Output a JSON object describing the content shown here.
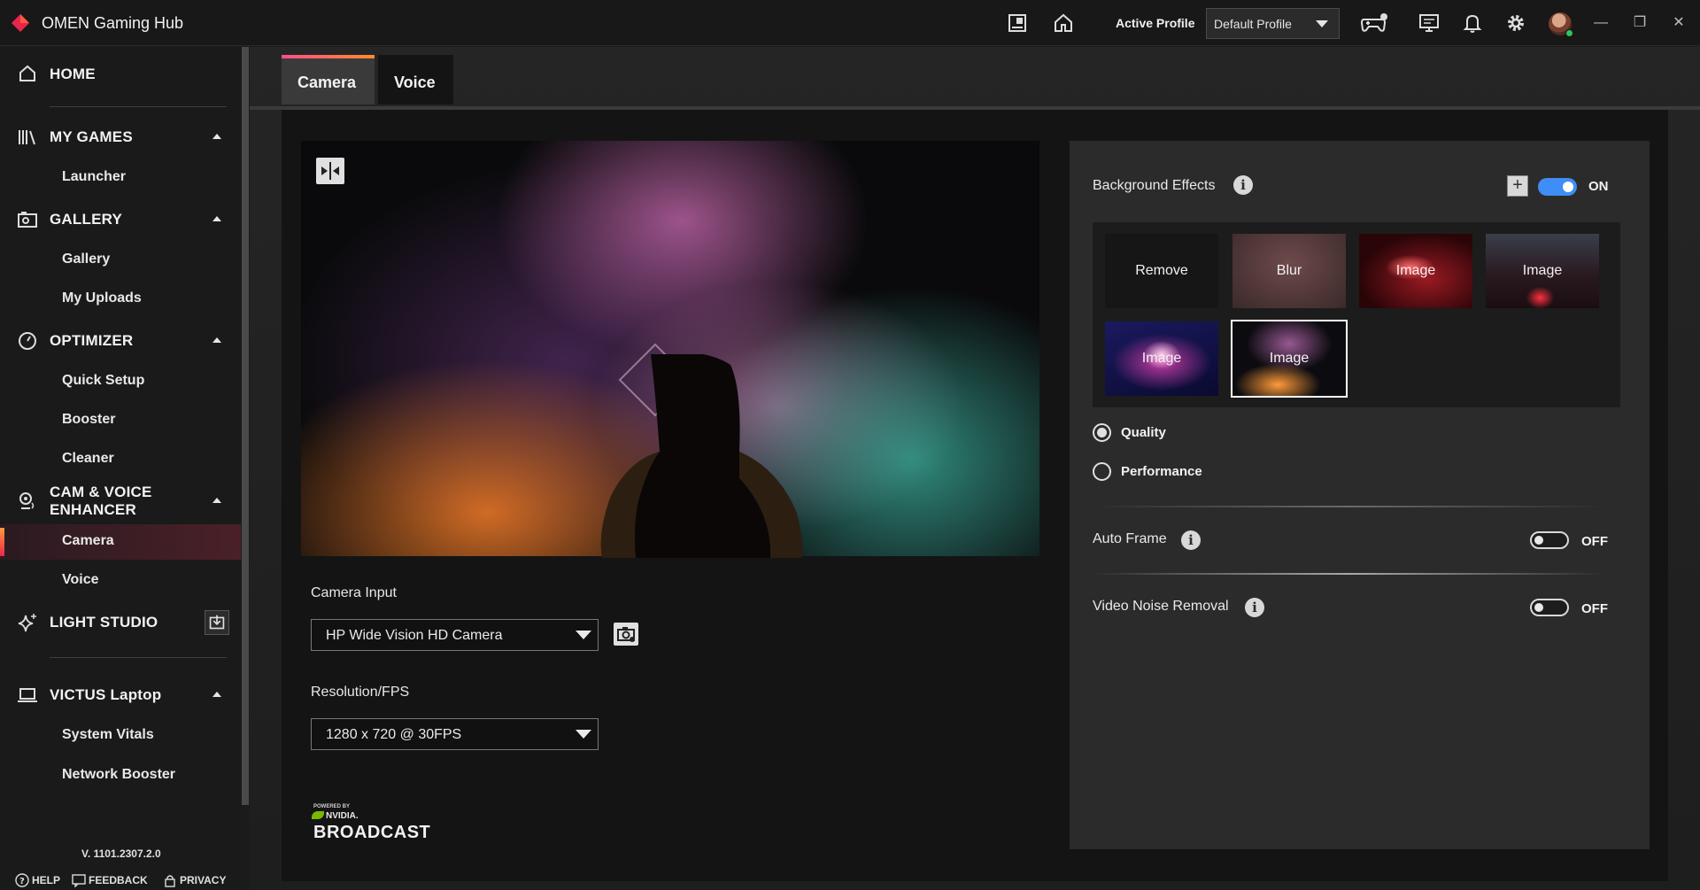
{
  "app": {
    "title": "OMEN Gaming Hub",
    "accent": "#e8264d"
  },
  "titlebar": {
    "active_profile_label": "Active Profile",
    "profile_value": "Default Profile",
    "icons": [
      "news-icon",
      "home-icon",
      "controller-icon",
      "display-icon",
      "bell-icon",
      "gear-icon",
      "avatar"
    ]
  },
  "sidebar": {
    "home": "HOME",
    "my_games": "MY GAMES",
    "launcher": "Launcher",
    "gallery_section": "GALLERY",
    "gallery": "Gallery",
    "my_uploads": "My Uploads",
    "optimizer": "OPTIMIZER",
    "quick_setup": "Quick Setup",
    "booster": "Booster",
    "cleaner": "Cleaner",
    "cam_voice_1": "CAM & VOICE",
    "cam_voice_2": "ENHANCER",
    "camera": "Camera",
    "voice": "Voice",
    "light_studio": "LIGHT STUDIO",
    "victus": "VICTUS Laptop",
    "system_vitals": "System Vitals",
    "network_booster": "Network Booster",
    "version": "V. 1101.2307.2.0",
    "help": "HELP",
    "feedback": "FEEDBACK",
    "privacy": "PRIVACY"
  },
  "tabs": {
    "camera": "Camera",
    "voice": "Voice",
    "active": "Camera"
  },
  "camera": {
    "input_label": "Camera Input",
    "input_value": "HP Wide Vision HD Camera",
    "resolution_label": "Resolution/FPS",
    "resolution_value": "1280 x 720 @ 30FPS",
    "powered_by": "POWERED BY",
    "nvidia": "NVIDIA.",
    "broadcast": "BROADCAST"
  },
  "effects": {
    "title": "Background Effects",
    "state": "ON",
    "tiles": [
      "Remove",
      "Blur",
      "Image",
      "Image",
      "Image",
      "Image"
    ],
    "selected_index": 5,
    "quality": "Quality",
    "performance": "Performance",
    "mode_selected": "Quality",
    "auto_frame": "Auto Frame",
    "auto_frame_state": "OFF",
    "noise_removal": "Video Noise Removal",
    "noise_removal_state": "OFF",
    "toggle_on_color": "#3f8ef5"
  }
}
